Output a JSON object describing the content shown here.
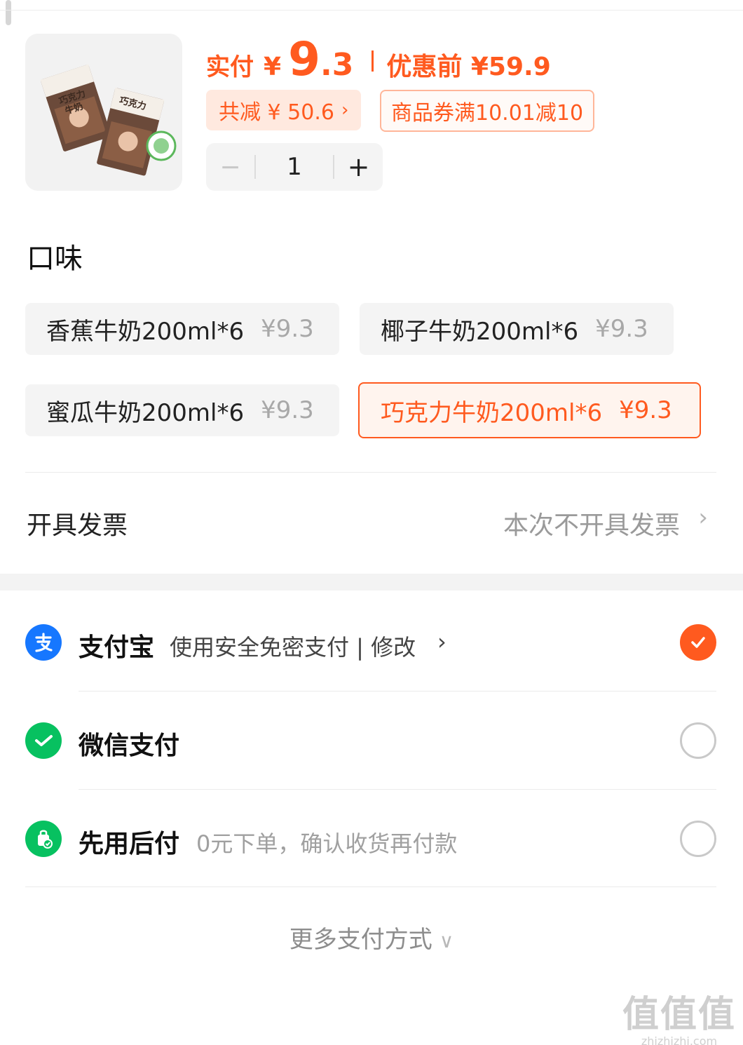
{
  "product": {
    "image_alt": "巧克力牛奶",
    "paid_label": "实付",
    "currency": "¥",
    "paid_integer": "9",
    "paid_decimal": ".3",
    "before_discount": "优惠前 ¥59.9",
    "total_discount": "共减 ¥ 50.6",
    "coupon": "商品券满10.01减10",
    "quantity": "1",
    "pack_text_1": "巧克力",
    "pack_text_2": "牛奶"
  },
  "flavor": {
    "title": "口味",
    "options": [
      {
        "name": "香蕉牛奶200ml*6",
        "price": "¥9.3",
        "selected": false
      },
      {
        "name": "椰子牛奶200ml*6",
        "price": "¥9.3",
        "selected": false
      },
      {
        "name": "蜜瓜牛奶200ml*6",
        "price": "¥9.3",
        "selected": false
      },
      {
        "name": "巧克力牛奶200ml*6",
        "price": "¥9.3",
        "selected": true
      }
    ]
  },
  "invoice": {
    "label": "开具发票",
    "value": "本次不开具发票"
  },
  "payment": {
    "methods": [
      {
        "name": "支付宝",
        "desc": "使用安全免密支付 | 修改",
        "selected": true,
        "icon": "alipay-icon"
      },
      {
        "name": "微信支付",
        "desc": "",
        "selected": false,
        "icon": "wechat-pay-icon"
      },
      {
        "name": "先用后付",
        "desc": "0元下单，确认收货再付款",
        "selected": false,
        "icon": "pay-later-icon"
      }
    ],
    "more": "更多支付方式"
  },
  "watermark": {
    "logo": "值值值",
    "url": "zhizhizhi.com"
  },
  "colors": {
    "accent": "#ff5a1f",
    "alipay": "#1677ff",
    "wechat": "#07c160"
  }
}
